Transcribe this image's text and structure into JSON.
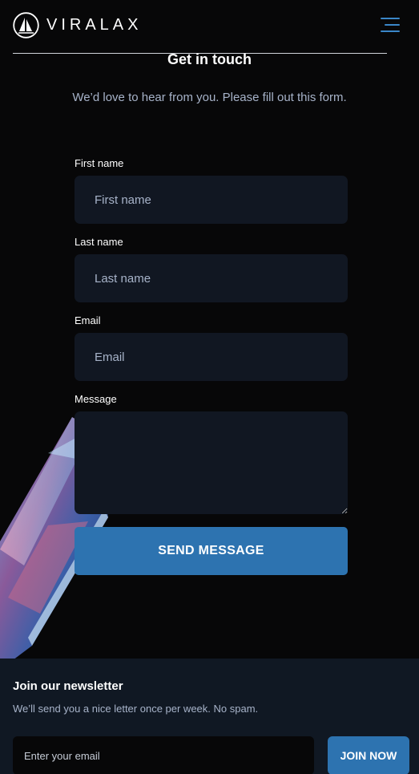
{
  "header": {
    "brand": "VIRALAX",
    "logo_icon": "sailboat-logo-icon",
    "menu_icon": "hamburger-menu-icon"
  },
  "contact": {
    "title": "Get in touch",
    "subtitle": "We’d love to hear from you. Please fill out this form.",
    "fields": [
      {
        "label": "First name",
        "placeholder": "First name",
        "value": ""
      },
      {
        "label": "Last name",
        "placeholder": "Last name",
        "value": ""
      },
      {
        "label": "Email",
        "placeholder": "Email",
        "value": ""
      },
      {
        "label": "Message",
        "placeholder": "",
        "value": ""
      }
    ],
    "submit_label": "SEND MESSAGE"
  },
  "newsletter": {
    "title": "Join our newsletter",
    "text": "We’ll send you a nice letter once per week. No spam.",
    "input_placeholder": "Enter your email",
    "button_label": "JOIN NOW"
  },
  "colors": {
    "background": "#070708",
    "accent": "#2d73b0",
    "field_bg": "#111722",
    "muted_text": "#a7b3c9",
    "newsletter_bg": "#101823"
  }
}
